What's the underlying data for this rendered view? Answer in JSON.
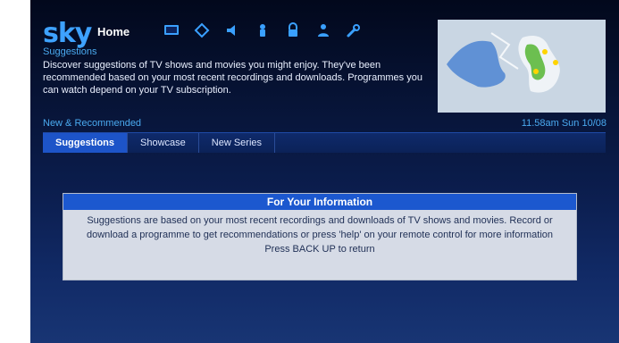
{
  "header": {
    "logo": "sky",
    "home_label": "Home"
  },
  "icons": [
    {
      "name": "tv-guide-icon"
    },
    {
      "name": "tag-icon"
    },
    {
      "name": "audio-icon"
    },
    {
      "name": "remote-icon"
    },
    {
      "name": "lock-icon"
    },
    {
      "name": "user-icon"
    },
    {
      "name": "wrench-icon"
    }
  ],
  "suggestions": {
    "title": "Suggestions",
    "description": "Discover suggestions of TV shows and movies you might enjoy. They've been recommended based on your most recent recordings and downloads. Programmes you can watch depend on your TV subscription."
  },
  "section": {
    "title": "New & Recommended",
    "datetime": "11.58am Sun 10/08"
  },
  "tabs": [
    {
      "label": "Suggestions",
      "active": true
    },
    {
      "label": "Showcase",
      "active": false
    },
    {
      "label": "New Series",
      "active": false
    }
  ],
  "info_box": {
    "title": "For Your Information",
    "body": "Suggestions are based on your most recent recordings and downloads of TV shows and movies. Record or download a programme to get recommendations or press 'help' on your remote control for more information",
    "footer": "Press BACK UP to return"
  },
  "colors": {
    "accent_blue": "#1c58cf",
    "text_blue": "#4aaaf0",
    "logo_blue": "#3ea2ff"
  }
}
